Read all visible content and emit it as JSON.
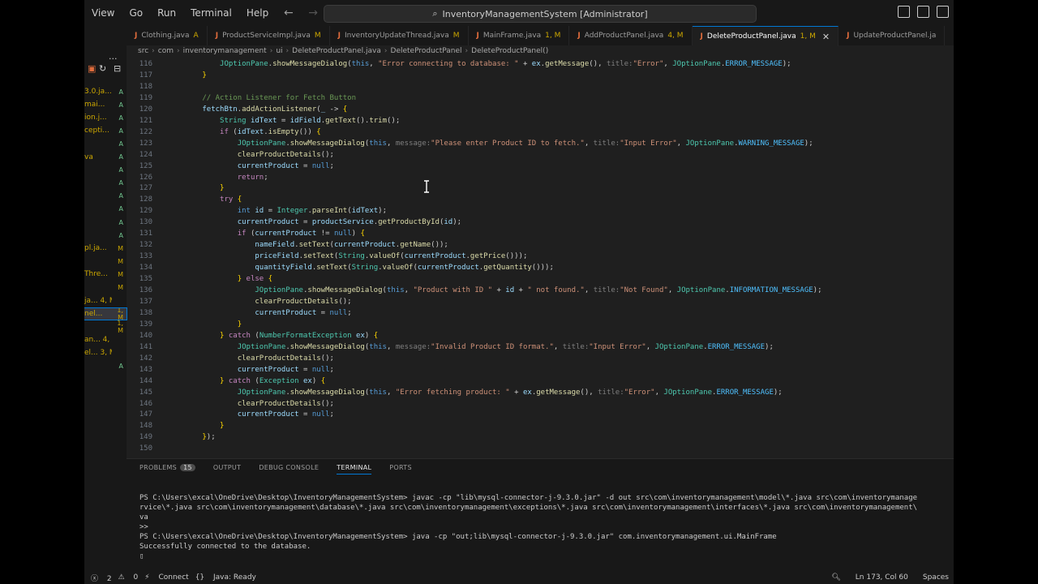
{
  "menu": [
    "View",
    "Go",
    "Run",
    "Terminal",
    "Help"
  ],
  "search_text": "InventoryManagementSystem [Administrator]",
  "explorer_rows": [
    {
      "name": "3.0.ja...",
      "status": "A"
    },
    {
      "name": "mai...",
      "status": "A"
    },
    {
      "name": "ion.j...",
      "status": "A"
    },
    {
      "name": "cepti...",
      "status": "A"
    },
    {
      "name": "",
      "status": "A"
    },
    {
      "name": "va",
      "status": "A"
    },
    {
      "name": "",
      "status": "A"
    },
    {
      "name": "",
      "status": "A"
    },
    {
      "name": "",
      "status": "A"
    },
    {
      "name": "",
      "status": "A"
    },
    {
      "name": "",
      "status": "A"
    },
    {
      "name": "",
      "status": "A"
    },
    {
      "name": "pl.ja...",
      "status": "M"
    },
    {
      "name": "",
      "status": "M"
    },
    {
      "name": "Thre...",
      "status": "M"
    },
    {
      "name": "",
      "status": "M"
    },
    {
      "name": "ja... 4, M",
      "status": ""
    },
    {
      "name": "nel...",
      "status": "1, M"
    },
    {
      "name": "",
      "status": "1, M"
    },
    {
      "name": "an... 4, M",
      "status": ""
    },
    {
      "name": "el... 3, M",
      "status": ""
    },
    {
      "name": "",
      "status": "A"
    }
  ],
  "tabs": [
    {
      "name": "Clothing.java",
      "status": "A",
      "active": false
    },
    {
      "name": "ProductServiceImpl.java",
      "status": "M",
      "active": false
    },
    {
      "name": "InventoryUpdateThread.java",
      "status": "M",
      "active": false
    },
    {
      "name": "MainFrame.java",
      "status": "1, M",
      "active": false
    },
    {
      "name": "AddProductPanel.java",
      "status": "4, M",
      "active": false
    },
    {
      "name": "DeleteProductPanel.java",
      "status": "1, M",
      "active": true
    },
    {
      "name": "UpdateProductPanel.ja",
      "status": "",
      "active": false
    }
  ],
  "breadcrumbs": [
    "src",
    "com",
    "inventorymanagement",
    "ui",
    "DeleteProductPanel.java",
    "DeleteProductPanel",
    "DeleteProductPanel()"
  ],
  "code_lines": [
    {
      "n": "116",
      "h": "            <span class=\"t\">JOptionPane</span>.<span class=\"f\">showMessageDialog</span>(<span class=\"n\">this</span>, <span class=\"s\">\"Error connecting to database: \"</span> + <span class=\"v\">ex</span>.<span class=\"f\">getMessage</span>(), <span class=\"h\">title:</span><span class=\"s\">\"Error\"</span>, <span class=\"t\">JOptionPane</span>.<span class=\"cst\">ERROR_MESSAGE</span>);"
    },
    {
      "n": "117",
      "h": "        <span class=\"p\">}</span>"
    },
    {
      "n": "118",
      "h": ""
    },
    {
      "n": "119",
      "h": "        <span class=\"c\">// Action Listener for Fetch Button</span>"
    },
    {
      "n": "120",
      "h": "        <span class=\"v\">fetchBtn</span>.<span class=\"f\">addActionListener</span>(<span class=\"v\">_</span> -> <span class=\"p\">{</span>"
    },
    {
      "n": "121",
      "h": "            <span class=\"t\">String</span> <span class=\"v\">idText</span> = <span class=\"v\">idField</span>.<span class=\"f\">getText</span>().<span class=\"f\">trim</span>();"
    },
    {
      "n": "122",
      "h": "            <span class=\"k\">if</span> (<span class=\"v\">idText</span>.<span class=\"f\">isEmpty</span>()) <span class=\"p\">{</span>"
    },
    {
      "n": "123",
      "h": "                <span class=\"t\">JOptionPane</span>.<span class=\"f\">showMessageDialog</span>(<span class=\"n\">this</span>, <span class=\"h\">message:</span><span class=\"s\">\"Please enter Product ID to fetch.\"</span>, <span class=\"h\">title:</span><span class=\"s\">\"Input Error\"</span>, <span class=\"t\">JOptionPane</span>.<span class=\"cst\">WARNING_MESSAGE</span>);"
    },
    {
      "n": "124",
      "h": "                <span class=\"f\">clearProductDetails</span>();"
    },
    {
      "n": "125",
      "h": "                <span class=\"v\">currentProduct</span> = <span class=\"n\">null</span>;"
    },
    {
      "n": "126",
      "h": "                <span class=\"k\">return</span>;"
    },
    {
      "n": "127",
      "h": "            <span class=\"p\">}</span>"
    },
    {
      "n": "128",
      "h": "            <span class=\"k\">try</span> <span class=\"p\">{</span>"
    },
    {
      "n": "129",
      "h": "                <span class=\"n\">int</span> <span class=\"v\">id</span> = <span class=\"t\">Integer</span>.<span class=\"f\">parseInt</span>(<span class=\"v\">idText</span>);"
    },
    {
      "n": "130",
      "h": "                <span class=\"v\">currentProduct</span> = <span class=\"v\">productService</span>.<span class=\"f\">getProductById</span>(<span class=\"v\">id</span>);"
    },
    {
      "n": "131",
      "h": "                <span class=\"k\">if</span> (<span class=\"v\">currentProduct</span> != <span class=\"n\">null</span>) <span class=\"p\">{</span>"
    },
    {
      "n": "132",
      "h": "                    <span class=\"v\">nameField</span>.<span class=\"f\">setText</span>(<span class=\"v\">currentProduct</span>.<span class=\"f\">getName</span>());"
    },
    {
      "n": "133",
      "h": "                    <span class=\"v\">priceField</span>.<span class=\"f\">setText</span>(<span class=\"t\">String</span>.<span class=\"f\">valueOf</span>(<span class=\"v\">currentProduct</span>.<span class=\"f\">getPrice</span>()));"
    },
    {
      "n": "134",
      "h": "                    <span class=\"v\">quantityField</span>.<span class=\"f\">setText</span>(<span class=\"t\">String</span>.<span class=\"f\">valueOf</span>(<span class=\"v\">currentProduct</span>.<span class=\"f\">getQuantity</span>()));"
    },
    {
      "n": "135",
      "h": "                <span class=\"p\">}</span> <span class=\"k\">else</span> <span class=\"p\">{</span>"
    },
    {
      "n": "136",
      "h": "                    <span class=\"t\">JOptionPane</span>.<span class=\"f\">showMessageDialog</span>(<span class=\"n\">this</span>, <span class=\"s\">\"Product with ID \"</span> + <span class=\"v\">id</span> + <span class=\"s\">\" not found.\"</span>, <span class=\"h\">title:</span><span class=\"s\">\"Not Found\"</span>, <span class=\"t\">JOptionPane</span>.<span class=\"cst\">INFORMATION_MESSAGE</span>);"
    },
    {
      "n": "137",
      "h": "                    <span class=\"f\">clearProductDetails</span>();"
    },
    {
      "n": "138",
      "h": "                    <span class=\"v\">currentProduct</span> = <span class=\"n\">null</span>;"
    },
    {
      "n": "139",
      "h": "                <span class=\"p\">}</span>"
    },
    {
      "n": "140",
      "h": "            <span class=\"p\">}</span> <span class=\"k\">catch</span> (<span class=\"t\">NumberFormatException</span> <span class=\"v\">ex</span>) <span class=\"p\">{</span>"
    },
    {
      "n": "141",
      "h": "                <span class=\"t\">JOptionPane</span>.<span class=\"f\">showMessageDialog</span>(<span class=\"n\">this</span>, <span class=\"h\">message:</span><span class=\"s\">\"Invalid Product ID format.\"</span>, <span class=\"h\">title:</span><span class=\"s\">\"Input Error\"</span>, <span class=\"t\">JOptionPane</span>.<span class=\"cst\">ERROR_MESSAGE</span>);"
    },
    {
      "n": "142",
      "h": "                <span class=\"f\">clearProductDetails</span>();"
    },
    {
      "n": "143",
      "h": "                <span class=\"v\">currentProduct</span> = <span class=\"n\">null</span>;"
    },
    {
      "n": "144",
      "h": "            <span class=\"p\">}</span> <span class=\"k\">catch</span> (<span class=\"t\">Exception</span> <span class=\"v\">ex</span>) <span class=\"p\">{</span>"
    },
    {
      "n": "145",
      "h": "                <span class=\"t\">JOptionPane</span>.<span class=\"f\">showMessageDialog</span>(<span class=\"n\">this</span>, <span class=\"s\">\"Error fetching product: \"</span> + <span class=\"v\">ex</span>.<span class=\"f\">getMessage</span>(), <span class=\"h\">title:</span><span class=\"s\">\"Error\"</span>, <span class=\"t\">JOptionPane</span>.<span class=\"cst\">ERROR_MESSAGE</span>);"
    },
    {
      "n": "146",
      "h": "                <span class=\"f\">clearProductDetails</span>();"
    },
    {
      "n": "147",
      "h": "                <span class=\"v\">currentProduct</span> = <span class=\"n\">null</span>;"
    },
    {
      "n": "148",
      "h": "            <span class=\"p\">}</span>"
    },
    {
      "n": "149",
      "h": "        <span class=\"p\">}</span>);"
    },
    {
      "n": "150",
      "h": ""
    }
  ],
  "panel": {
    "tabs": [
      "PROBLEMS",
      "OUTPUT",
      "DEBUG CONSOLE",
      "TERMINAL",
      "PORTS"
    ],
    "problems_count": "15",
    "active_tab": "TERMINAL",
    "terminal_lines": [
      "PS C:\\Users\\excal\\OneDrive\\Desktop\\InventoryManagementSystem> javac -cp \"lib\\mysql-connector-j-9.3.0.jar\" -d out src\\com\\inventorymanagement\\model\\*.java src\\com\\inventorymanage",
      "rvice\\*.java src\\com\\inventorymanagement\\database\\*.java src\\com\\inventorymanagement\\exceptions\\*.java src\\com\\inventorymanagement\\interfaces\\*.java src\\com\\inventorymanagement\\",
      "va",
      ">>",
      "PS C:\\Users\\excal\\OneDrive\\Desktop\\InventoryManagementSystem> java -cp \"out;lib\\mysql-connector-j-9.3.0.jar\" com.inventorymanagement.ui.MainFrame",
      "Successfully connected to the database.",
      "▯"
    ]
  },
  "status": {
    "errors": "2",
    "warnings": "0",
    "connect": "Connect",
    "java": "Java: Ready",
    "position": "Ln 173, Col 60",
    "spaces": "Spaces"
  }
}
